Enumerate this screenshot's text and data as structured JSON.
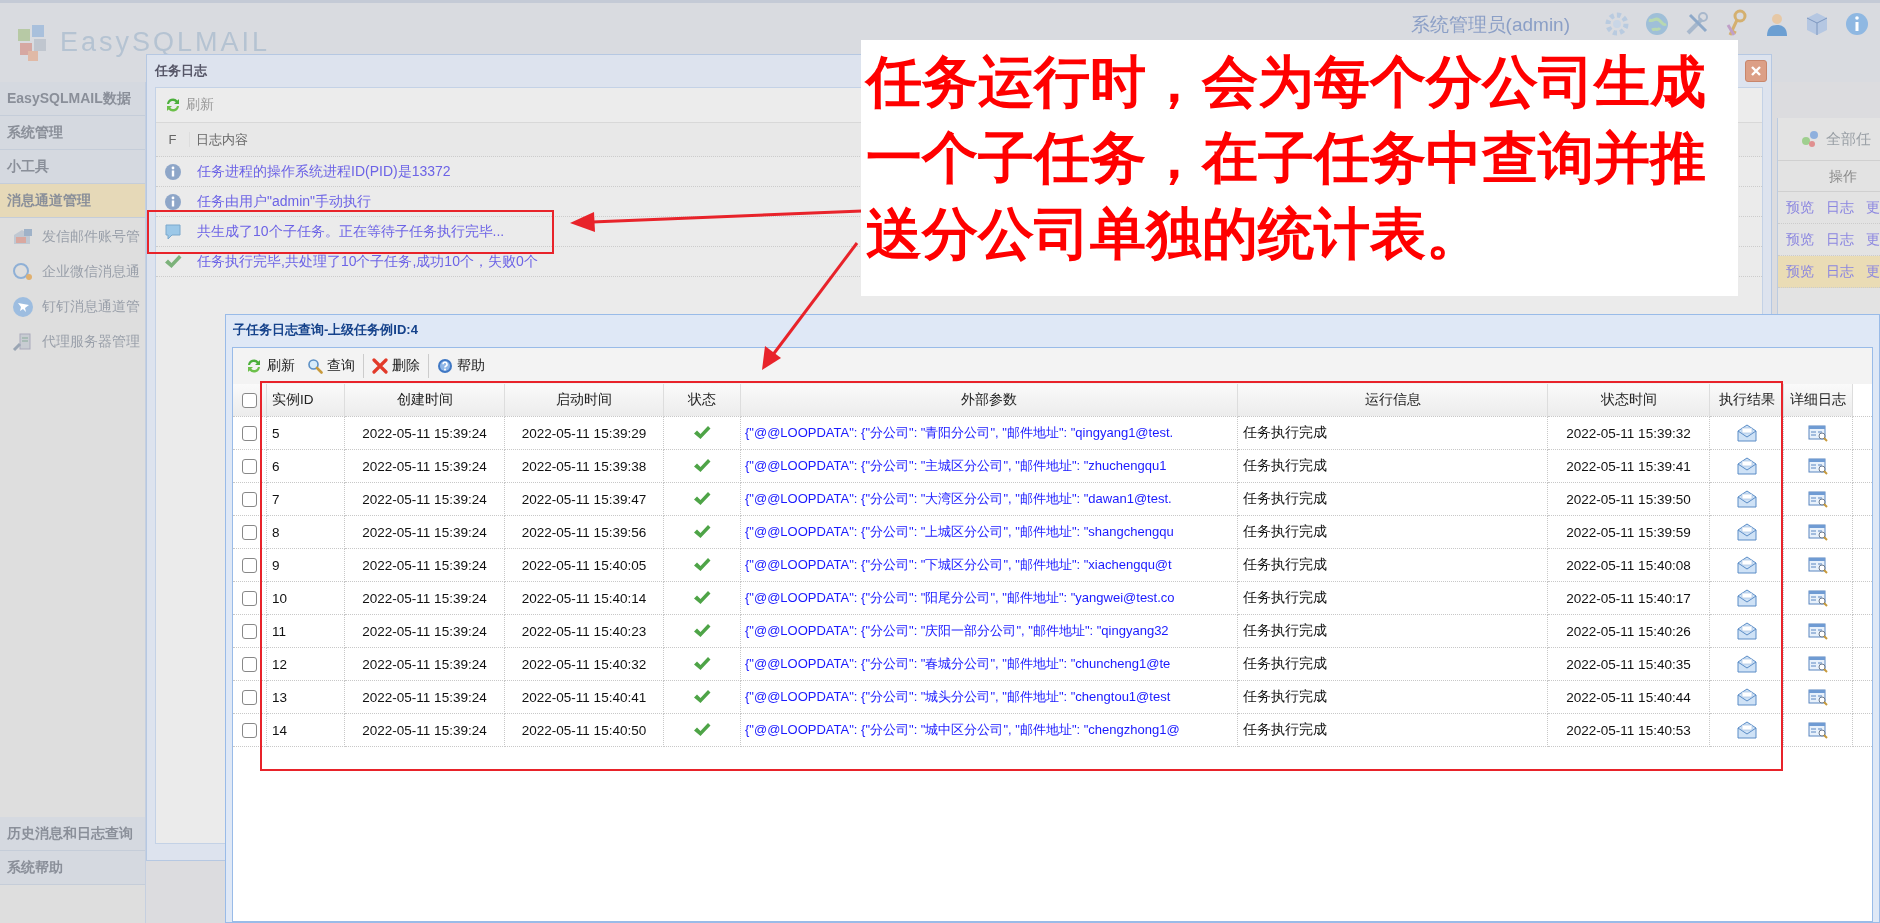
{
  "app": {
    "logo": "EasySQLMAIL",
    "user": "系统管理员(admin)"
  },
  "sidebar": {
    "sections": [
      {
        "label": "EasySQLMAIL数据",
        "selected": false
      },
      {
        "label": "系统管理",
        "selected": false
      },
      {
        "label": "小工具",
        "selected": false
      },
      {
        "label": "消息通道管理",
        "selected": true
      }
    ],
    "items": [
      {
        "kind": "mail",
        "label": "发信邮件账号管"
      },
      {
        "kind": "wechat",
        "label": "企业微信消息通"
      },
      {
        "kind": "dingtalk",
        "label": "钉钉消息通道管"
      },
      {
        "kind": "server",
        "label": "代理服务器管理"
      }
    ],
    "bottom_sections": [
      {
        "label": "历史消息和日志查询",
        "selected": false
      },
      {
        "label": "系统帮助",
        "selected": false
      }
    ]
  },
  "task_panel": {
    "toolbar": "全部任",
    "column": "操作",
    "rows": [
      {
        "actions": [
          "预览",
          "日志",
          "更"
        ],
        "selected": false
      },
      {
        "actions": [
          "预览",
          "日志",
          "更"
        ],
        "selected": false
      },
      {
        "actions": [
          "预览",
          "日志",
          "更"
        ],
        "selected": true
      }
    ]
  },
  "task_log_window": {
    "title": "任务日志",
    "toolbar": [
      "刷新"
    ],
    "columns": [
      "F",
      "日志内容"
    ],
    "rows": [
      {
        "kind": "info",
        "text": "任务进程的操作系统进程ID(PID)是13372"
      },
      {
        "kind": "info",
        "text": "任务由用户\"admin\"手动执行"
      },
      {
        "kind": "message",
        "text": "共生成了10个子任务。正在等待子任务执行完毕..."
      },
      {
        "kind": "success",
        "text": "任务执行完毕,共处理了10个子任务,成功10个，失败0个"
      }
    ]
  },
  "subtask_window": {
    "title": "子任务日志查询-上级任务例ID:4",
    "toolbar": [
      {
        "kind": "refresh",
        "label": "刷新"
      },
      {
        "kind": "search",
        "label": "查询"
      },
      {
        "kind": "delete",
        "label": "删除"
      },
      {
        "kind": "help",
        "label": "帮助"
      }
    ],
    "select_all_checked": false,
    "columns": [
      "实例ID",
      "创建时间",
      "启动时间",
      "状态",
      "外部参数",
      "运行信息",
      "状态时间",
      "执行结果",
      "详细日志"
    ],
    "rows": [
      {
        "checked": false,
        "id": "5",
        "created": "2022-05-11 15:39:24",
        "started": "2022-05-11 15:39:29",
        "succeeded": true,
        "params": "{\"@@LOOPDATA\": {\"分公司\": \"青阳分公司\", \"邮件地址\": \"qingyang1@test.",
        "info": "任务执行完成",
        "status_time": "2022-05-11 15:39:32"
      },
      {
        "checked": false,
        "id": "6",
        "created": "2022-05-11 15:39:24",
        "started": "2022-05-11 15:39:38",
        "succeeded": true,
        "params": "{\"@@LOOPDATA\": {\"分公司\": \"主城区分公司\", \"邮件地址\": \"zhuchengqu1",
        "info": "任务执行完成",
        "status_time": "2022-05-11 15:39:41"
      },
      {
        "checked": false,
        "id": "7",
        "created": "2022-05-11 15:39:24",
        "started": "2022-05-11 15:39:47",
        "succeeded": true,
        "params": "{\"@@LOOPDATA\": {\"分公司\": \"大湾区分公司\", \"邮件地址\": \"dawan1@test.",
        "info": "任务执行完成",
        "status_time": "2022-05-11 15:39:50"
      },
      {
        "checked": false,
        "id": "8",
        "created": "2022-05-11 15:39:24",
        "started": "2022-05-11 15:39:56",
        "succeeded": true,
        "params": "{\"@@LOOPDATA\": {\"分公司\": \"上城区分公司\", \"邮件地址\": \"shangchengqu",
        "info": "任务执行完成",
        "status_time": "2022-05-11 15:39:59"
      },
      {
        "checked": false,
        "id": "9",
        "created": "2022-05-11 15:39:24",
        "started": "2022-05-11 15:40:05",
        "succeeded": true,
        "params": "{\"@@LOOPDATA\": {\"分公司\": \"下城区分公司\", \"邮件地址\": \"xiachengqu@t",
        "info": "任务执行完成",
        "status_time": "2022-05-11 15:40:08"
      },
      {
        "checked": false,
        "id": "10",
        "created": "2022-05-11 15:39:24",
        "started": "2022-05-11 15:40:14",
        "succeeded": true,
        "params": "{\"@@LOOPDATA\": {\"分公司\": \"阳尾分公司\", \"邮件地址\": \"yangwei@test.co",
        "info": "任务执行完成",
        "status_time": "2022-05-11 15:40:17"
      },
      {
        "checked": false,
        "id": "11",
        "created": "2022-05-11 15:39:24",
        "started": "2022-05-11 15:40:23",
        "succeeded": true,
        "params": "{\"@@LOOPDATA\": {\"分公司\": \"庆阳一部分公司\", \"邮件地址\": \"qingyang32",
        "info": "任务执行完成",
        "status_time": "2022-05-11 15:40:26"
      },
      {
        "checked": false,
        "id": "12",
        "created": "2022-05-11 15:39:24",
        "started": "2022-05-11 15:40:32",
        "succeeded": true,
        "params": "{\"@@LOOPDATA\": {\"分公司\": \"春城分公司\", \"邮件地址\": \"chuncheng1@te",
        "info": "任务执行完成",
        "status_time": "2022-05-11 15:40:35"
      },
      {
        "checked": false,
        "id": "13",
        "created": "2022-05-11 15:39:24",
        "started": "2022-05-11 15:40:41",
        "succeeded": true,
        "params": "{\"@@LOOPDATA\": {\"分公司\": \"城头分公司\", \"邮件地址\": \"chengtou1@test",
        "info": "任务执行完成",
        "status_time": "2022-05-11 15:40:44"
      },
      {
        "checked": false,
        "id": "14",
        "created": "2022-05-11 15:39:24",
        "started": "2022-05-11 15:40:50",
        "succeeded": true,
        "params": "{\"@@LOOPDATA\": {\"分公司\": \"城中区分公司\", \"邮件地址\": \"chengzhong1@",
        "info": "任务执行完成",
        "status_time": "2022-05-11 15:40:53"
      }
    ]
  },
  "annotation": {
    "lines": [
      "任务运行时，会为每个分公司生成",
      "一个子任务，在子任务中查询并推",
      "送分公司单独的统计表。"
    ]
  }
}
